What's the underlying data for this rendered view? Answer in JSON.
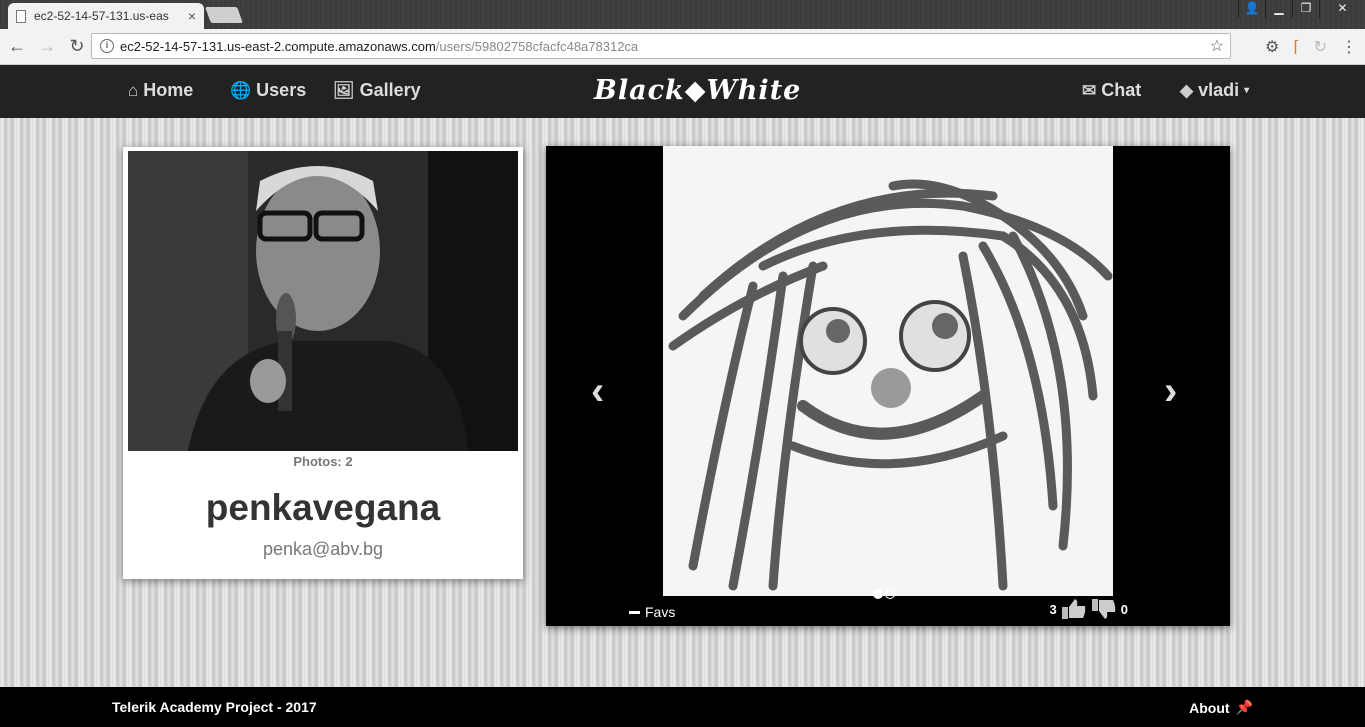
{
  "browser": {
    "tab_title": "ec2-52-14-57-131.us-eas",
    "tab_close": "×",
    "url_host": "ec2-52-14-57-131.us-east-2.compute.amazonaws.com",
    "url_path": "/users/59802758cfacfc48a78312ca"
  },
  "nav": {
    "home_label": "Home",
    "users_label": "Users",
    "gallery_label": "Gallery",
    "logo_text": "Black◆White",
    "chat_label": "Chat",
    "user_label": "vladi"
  },
  "profile": {
    "photos_count": "Photos: 2",
    "username": "penkavegana",
    "email": "penka@abv.bg"
  },
  "carousel": {
    "prev_glyph": "‹",
    "next_glyph": "›",
    "favs_label": "Favs",
    "likes": "3",
    "dislikes": "0",
    "slide_count": 2,
    "active_slide": 1
  },
  "footer": {
    "left_text": "Telerik Academy Project - 2017",
    "about_label": "About"
  },
  "colors": {
    "navbar": "#222222",
    "footer": "#000000",
    "carousel_bg": "#000000"
  }
}
